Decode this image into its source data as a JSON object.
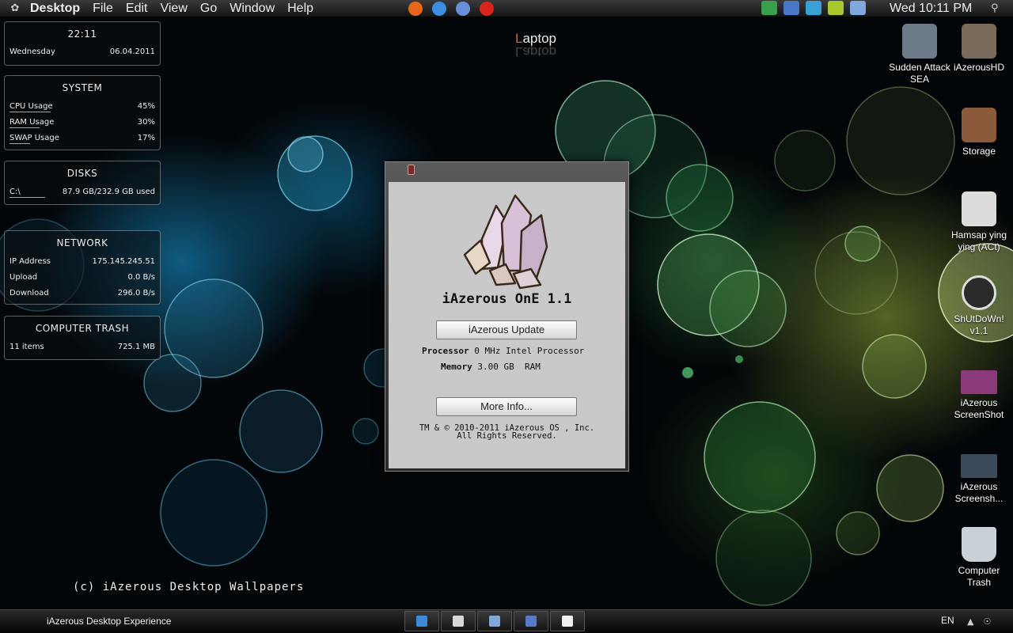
{
  "menubar": {
    "menus": [
      "Desktop",
      "File",
      "Edit",
      "View",
      "Go",
      "Window",
      "Help"
    ],
    "app_icons": [
      {
        "name": "firefox-icon",
        "color": "#e8661a"
      },
      {
        "name": "chrome-icon",
        "color": "#3c8ee0"
      },
      {
        "name": "safari-icon",
        "color": "#6a8fd8"
      },
      {
        "name": "opera-icon",
        "color": "#d8251c"
      }
    ],
    "tray_icons": [
      {
        "name": "status-icon",
        "color": "#3aa050"
      },
      {
        "name": "monitor-icon",
        "color": "#4a78c8"
      },
      {
        "name": "network-globe-icon",
        "color": "#3aa0d8"
      },
      {
        "name": "battery-icon",
        "color": "#a8c830"
      },
      {
        "name": "display-icon",
        "color": "#7fa8e0"
      }
    ],
    "clock": "Wed 10:11 PM"
  },
  "widgets": {
    "clock": {
      "time": "22:11",
      "day": "Wednesday",
      "date": "06.04.2011"
    },
    "system": {
      "title": "SYSTEM",
      "rows": [
        {
          "label": "CPU Usage",
          "value": "45%",
          "level": 0.45
        },
        {
          "label": "RAM Usage",
          "value": "30%",
          "level": 0.3
        },
        {
          "label": "SWAP Usage",
          "value": "17%",
          "level": 0.17
        }
      ]
    },
    "disks": {
      "title": "DISKS",
      "label": "C:\\",
      "value": "87.9 GB/232.9 GB used",
      "level": 0.38
    },
    "network": {
      "title": "NETWORK",
      "rows": [
        {
          "label": "IP Address",
          "value": "175.145.245.51"
        },
        {
          "label": "Upload",
          "value": "0.0 B/s"
        },
        {
          "label": "Download",
          "value": "296.0 B/s"
        }
      ]
    },
    "trash": {
      "title": "COMPUTER TRASH",
      "label": "11 items",
      "value": "725.1 MB"
    }
  },
  "desktop": {
    "laptop_first": "L",
    "laptop_rest": "aptop",
    "laptop_full": "Laptop",
    "wallpaper_credit": "(c) iAzerous Desktop Wallpapers",
    "icons": [
      {
        "label": "Sudden Attack SEA",
        "color": "#6c7a8a"
      },
      {
        "label": "iAzerousHD",
        "color": "#7a6a5a"
      },
      {
        "label": "Storage",
        "color": "#8a5a3a"
      },
      {
        "label": "Hamsap ying ying  (ACt)",
        "color": "#dcdcdc"
      },
      {
        "label": "ShUtDoWn! v1.1",
        "color": "#2a2a2a"
      },
      {
        "label": "iAzerous ScreenShot",
        "color": "#8a3a7a"
      },
      {
        "label": "iAzerous Screensh...",
        "color": "#3a4a5a"
      },
      {
        "label": "Computer Trash",
        "color": "#c8d0d8"
      }
    ]
  },
  "dialog": {
    "title": "iAzerous OnE 1.1",
    "update_button": "iAzerous Update",
    "processor_label": "Processor",
    "processor_value": "0 MHz Intel Processor",
    "memory_label": "Memory",
    "memory_value": "3.00 GB  RAM",
    "more_info_button": "More Info...",
    "copyright_line1": "TM & © 2010-2011 iAzerous OS , Inc.",
    "copyright_line2": "All Rights Reserved."
  },
  "taskbar": {
    "start_label": "iAzerous Desktop Experience",
    "buttons": [
      {
        "name": "globe-task-icon",
        "color": "#3a8ad8"
      },
      {
        "name": "notes-task-icon",
        "color": "#d8d8d8"
      },
      {
        "name": "explorer-task-icon",
        "color": "#7fa8d8"
      },
      {
        "name": "finder-task-icon",
        "color": "#5a78c8"
      },
      {
        "name": "document-task-icon",
        "color": "#f0f0f0"
      }
    ],
    "language": "EN"
  }
}
